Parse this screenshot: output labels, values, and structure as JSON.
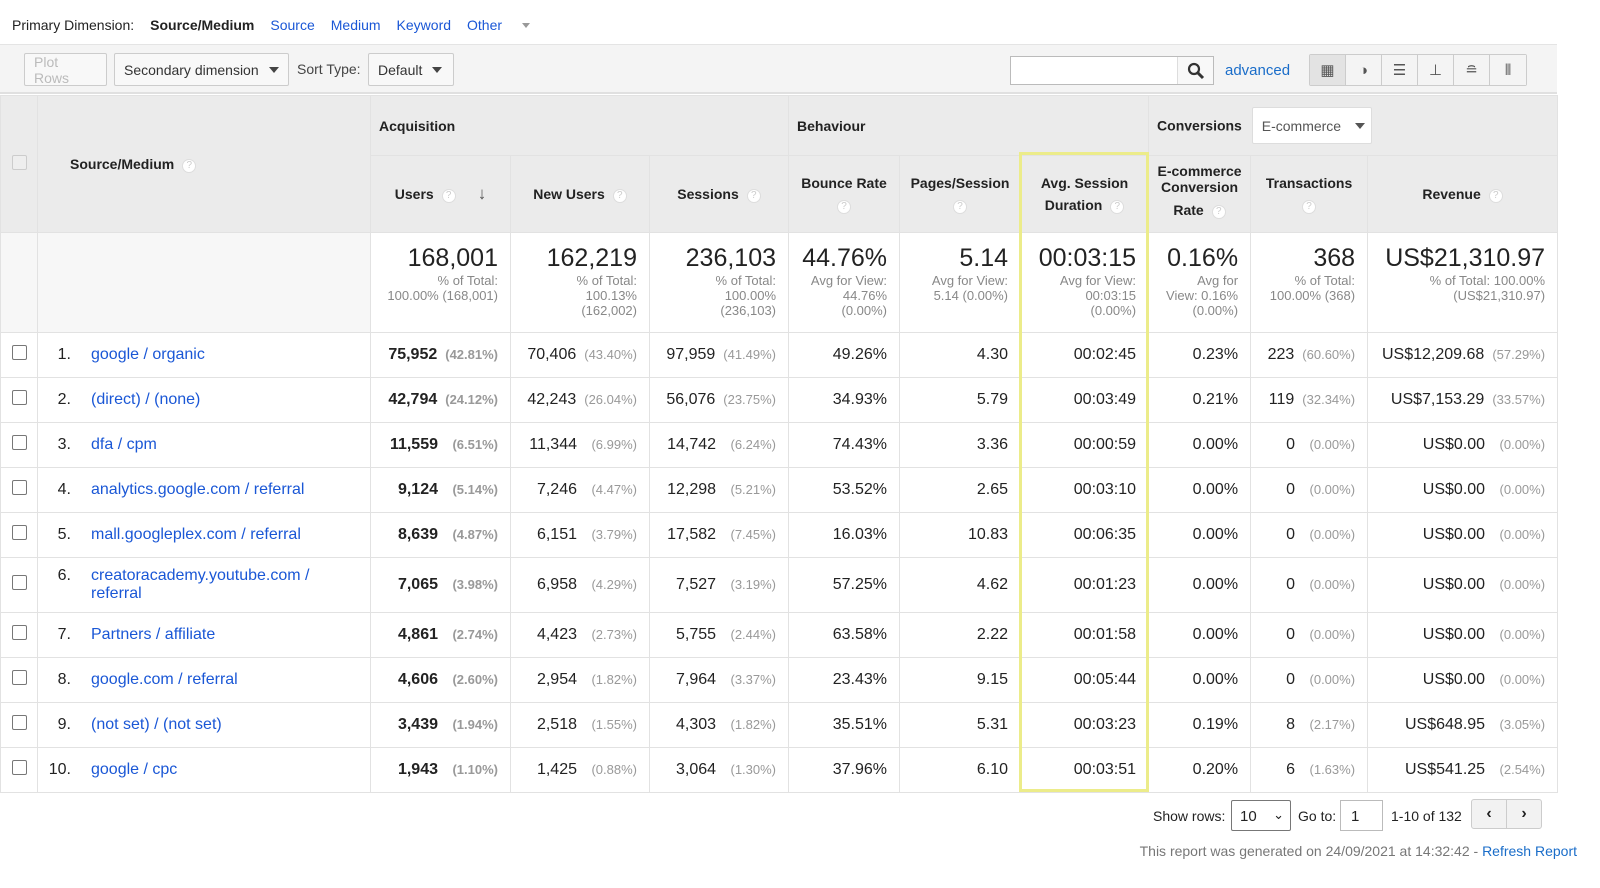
{
  "primary_dimension": {
    "label": "Primary Dimension:",
    "current": "Source/Medium",
    "options": [
      "Source",
      "Medium",
      "Keyword"
    ],
    "other": "Other"
  },
  "toolbar": {
    "plot_rows": "Plot Rows",
    "secondary_dimension": "Secondary dimension",
    "sort_type_label": "Sort Type:",
    "sort_type_value": "Default",
    "search_value": "",
    "advanced": "advanced",
    "views": [
      "table-view",
      "pie-view",
      "performance-view",
      "comparison-view",
      "term-cloud-view",
      "pivot-view"
    ]
  },
  "table": {
    "groups": {
      "acquisition": "Acquisition",
      "behaviour": "Behaviour",
      "conversions": "Conversions",
      "conversions_select": "E-commerce"
    },
    "columns": {
      "dimension": "Source/Medium",
      "users": "Users",
      "new_users": "New Users",
      "sessions": "Sessions",
      "bounce_rate": "Bounce Rate",
      "pages_session": "Pages/Session",
      "avg_session_1": "Avg. Session",
      "avg_session_2": "Duration",
      "conv_rate_1": "E-commerce",
      "conv_rate_2": "Conversion",
      "conv_rate_3": "Rate",
      "transactions": "Transactions",
      "revenue": "Revenue"
    },
    "totals": {
      "users": {
        "value": "168,001",
        "sub": [
          "% of Total:",
          "100.00% (168,001)"
        ]
      },
      "new_users": {
        "value": "162,219",
        "sub": [
          "% of Total:",
          "100.13%",
          "(162,002)"
        ]
      },
      "sessions": {
        "value": "236,103",
        "sub": [
          "% of Total:",
          "100.00%",
          "(236,103)"
        ]
      },
      "bounce_rate": {
        "value": "44.76%",
        "sub": [
          "Avg for View:",
          "44.76%",
          "(0.00%)"
        ]
      },
      "pages_session": {
        "value": "5.14",
        "sub": [
          "Avg for View:",
          "5.14 (0.00%)"
        ]
      },
      "avg_session": {
        "value": "00:03:15",
        "sub": [
          "Avg for View:",
          "00:03:15",
          "(0.00%)"
        ]
      },
      "conv_rate": {
        "value": "0.16%",
        "sub": [
          "Avg for",
          "View: 0.16%",
          "(0.00%)"
        ]
      },
      "transactions": {
        "value": "368",
        "sub": [
          "% of Total:",
          "100.00% (368)"
        ]
      },
      "revenue": {
        "value": "US$21,310.97",
        "sub": [
          "% of Total: 100.00%",
          "(US$21,310.97)"
        ]
      }
    },
    "rows": [
      {
        "n": "1.",
        "src": "google / organic",
        "users": "75,952",
        "users_p": "(42.81%)",
        "new": "70,406",
        "new_p": "(43.40%)",
        "sess": "97,959",
        "sess_p": "(41.49%)",
        "bounce": "49.26%",
        "pages": "4.30",
        "dur": "00:02:45",
        "conv": "0.23%",
        "trans": "223",
        "trans_p": "(60.60%)",
        "rev": "US$12,209.68",
        "rev_p": "(57.29%)"
      },
      {
        "n": "2.",
        "src": "(direct) / (none)",
        "users": "42,794",
        "users_p": "(24.12%)",
        "new": "42,243",
        "new_p": "(26.04%)",
        "sess": "56,076",
        "sess_p": "(23.75%)",
        "bounce": "34.93%",
        "pages": "5.79",
        "dur": "00:03:49",
        "conv": "0.21%",
        "trans": "119",
        "trans_p": "(32.34%)",
        "rev": "US$7,153.29",
        "rev_p": "(33.57%)"
      },
      {
        "n": "3.",
        "src": "dfa / cpm",
        "users": "11,559",
        "users_p": "(6.51%)",
        "new": "11,344",
        "new_p": "(6.99%)",
        "sess": "14,742",
        "sess_p": "(6.24%)",
        "bounce": "74.43%",
        "pages": "3.36",
        "dur": "00:00:59",
        "conv": "0.00%",
        "trans": "0",
        "trans_p": "(0.00%)",
        "rev": "US$0.00",
        "rev_p": "(0.00%)"
      },
      {
        "n": "4.",
        "src": "analytics.google.com / referral",
        "users": "9,124",
        "users_p": "(5.14%)",
        "new": "7,246",
        "new_p": "(4.47%)",
        "sess": "12,298",
        "sess_p": "(5.21%)",
        "bounce": "53.52%",
        "pages": "2.65",
        "dur": "00:03:10",
        "conv": "0.00%",
        "trans": "0",
        "trans_p": "(0.00%)",
        "rev": "US$0.00",
        "rev_p": "(0.00%)"
      },
      {
        "n": "5.",
        "src": "mall.googleplex.com / referral",
        "users": "8,639",
        "users_p": "(4.87%)",
        "new": "6,151",
        "new_p": "(3.79%)",
        "sess": "17,582",
        "sess_p": "(7.45%)",
        "bounce": "16.03%",
        "pages": "10.83",
        "dur": "00:06:35",
        "conv": "0.00%",
        "trans": "0",
        "trans_p": "(0.00%)",
        "rev": "US$0.00",
        "rev_p": "(0.00%)"
      },
      {
        "n": "6.",
        "src": "creatoracademy.youtube.com / referral",
        "users": "7,065",
        "users_p": "(3.98%)",
        "new": "6,958",
        "new_p": "(4.29%)",
        "sess": "7,527",
        "sess_p": "(3.19%)",
        "bounce": "57.25%",
        "pages": "4.62",
        "dur": "00:01:23",
        "conv": "0.00%",
        "trans": "0",
        "trans_p": "(0.00%)",
        "rev": "US$0.00",
        "rev_p": "(0.00%)"
      },
      {
        "n": "7.",
        "src": "Partners / affiliate",
        "users": "4,861",
        "users_p": "(2.74%)",
        "new": "4,423",
        "new_p": "(2.73%)",
        "sess": "5,755",
        "sess_p": "(2.44%)",
        "bounce": "63.58%",
        "pages": "2.22",
        "dur": "00:01:58",
        "conv": "0.00%",
        "trans": "0",
        "trans_p": "(0.00%)",
        "rev": "US$0.00",
        "rev_p": "(0.00%)"
      },
      {
        "n": "8.",
        "src": "google.com / referral",
        "users": "4,606",
        "users_p": "(2.60%)",
        "new": "2,954",
        "new_p": "(1.82%)",
        "sess": "7,964",
        "sess_p": "(3.37%)",
        "bounce": "23.43%",
        "pages": "9.15",
        "dur": "00:05:44",
        "conv": "0.00%",
        "trans": "0",
        "trans_p": "(0.00%)",
        "rev": "US$0.00",
        "rev_p": "(0.00%)"
      },
      {
        "n": "9.",
        "src": "(not set) / (not set)",
        "users": "3,439",
        "users_p": "(1.94%)",
        "new": "2,518",
        "new_p": "(1.55%)",
        "sess": "4,303",
        "sess_p": "(1.82%)",
        "bounce": "35.51%",
        "pages": "5.31",
        "dur": "00:03:23",
        "conv": "0.19%",
        "trans": "8",
        "trans_p": "(2.17%)",
        "rev": "US$648.95",
        "rev_p": "(3.05%)"
      },
      {
        "n": "10.",
        "src": "google / cpc",
        "users": "1,943",
        "users_p": "(1.10%)",
        "new": "1,425",
        "new_p": "(0.88%)",
        "sess": "3,064",
        "sess_p": "(1.30%)",
        "bounce": "37.96%",
        "pages": "6.10",
        "dur": "00:03:51",
        "conv": "0.20%",
        "trans": "6",
        "trans_p": "(1.63%)",
        "rev": "US$541.25",
        "rev_p": "(2.54%)"
      }
    ]
  },
  "footer": {
    "show_rows_label": "Show rows:",
    "show_rows_value": "10",
    "goto_label": "Go to:",
    "goto_value": "1",
    "range": "1-10 of 132",
    "generated": "This report was generated on 24/09/2021 at 14:32:42 - ",
    "refresh": "Refresh Report"
  },
  "colors": {
    "link": "#1a57d6",
    "highlight": "#ecec8a",
    "header_bg": "#ebebeb"
  }
}
